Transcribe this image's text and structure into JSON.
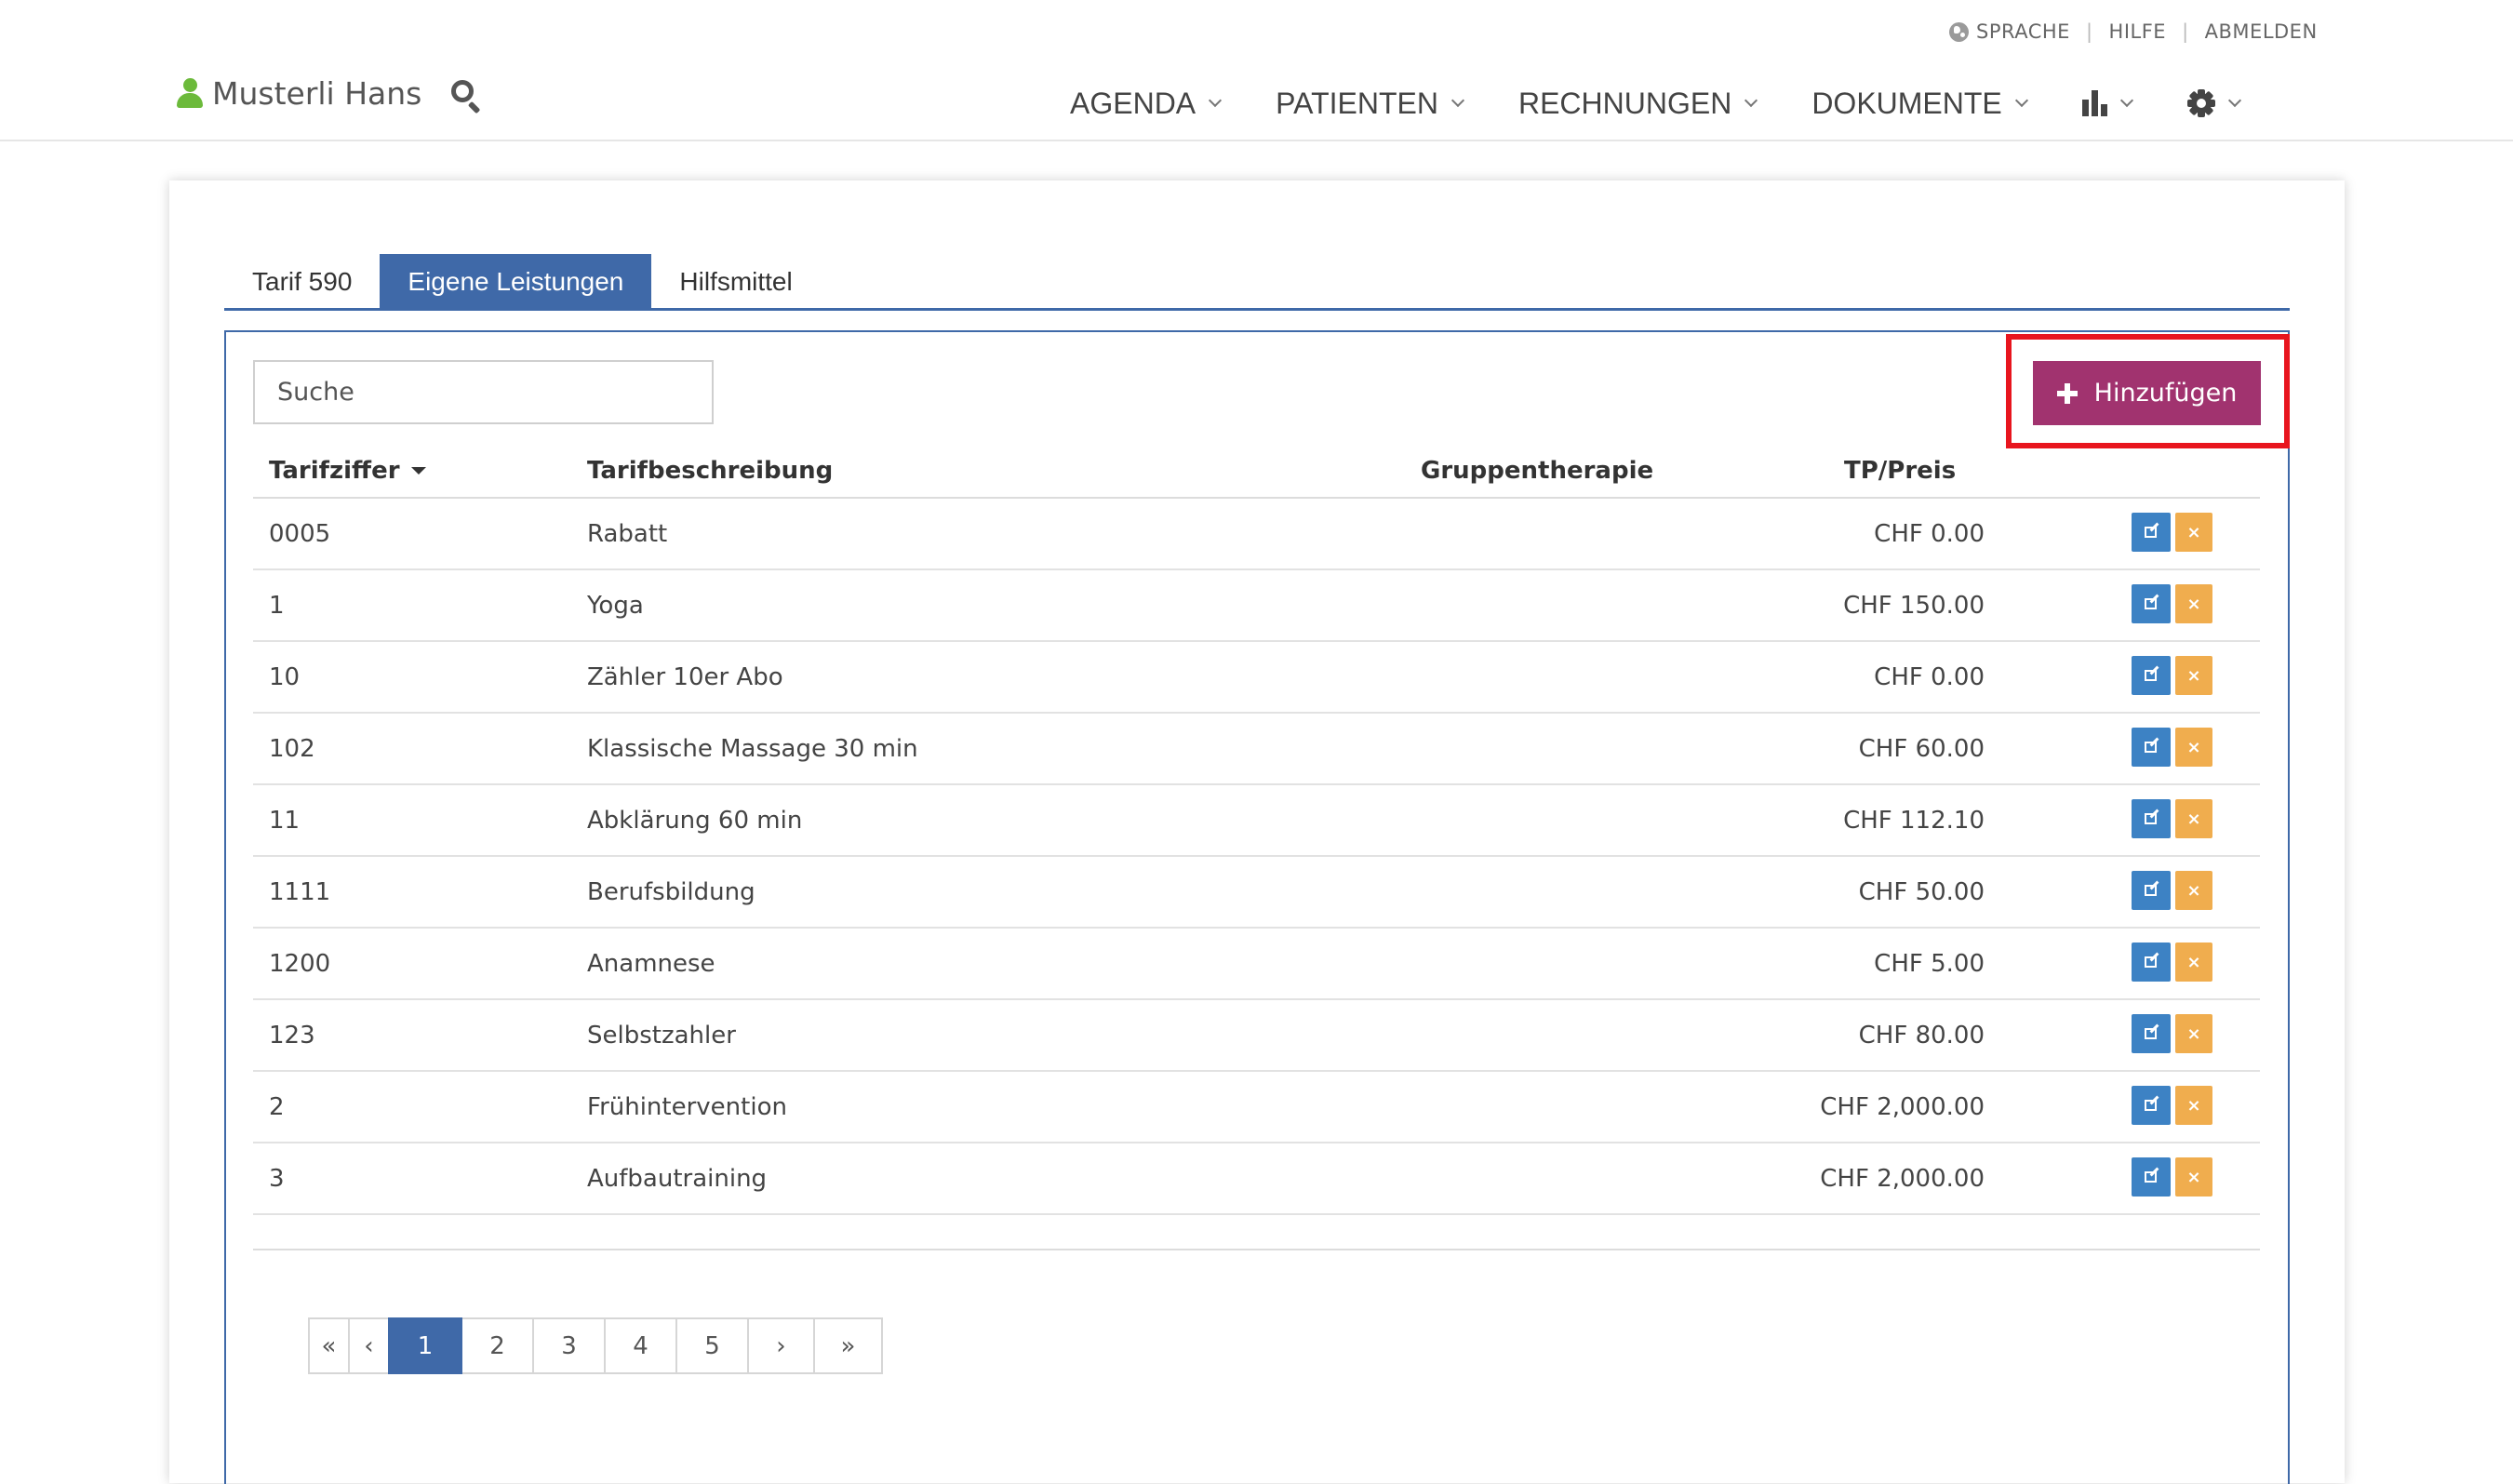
{
  "toplinks": {
    "language": "SPRACHE",
    "help": "HILFE",
    "logout": "ABMELDEN"
  },
  "header": {
    "user_name": "Musterli Hans"
  },
  "nav": {
    "agenda": "AGENDA",
    "patients": "PATIENTEN",
    "invoices": "RECHNUNGEN",
    "documents": "DOKUMENTE"
  },
  "tabs": [
    {
      "label": "Tarif 590"
    },
    {
      "label": "Eigene Leistungen",
      "active": true
    },
    {
      "label": "Hilfsmittel"
    }
  ],
  "search": {
    "placeholder": "Suche"
  },
  "add_button": {
    "label": "Hinzufügen"
  },
  "table": {
    "columns": {
      "code": "Tarifziffer",
      "description": "Tarifbeschreibung",
      "group": "Gruppentherapie",
      "price": "TP/Preis"
    },
    "rows": [
      {
        "code": "0005",
        "description": "Rabatt",
        "group": "",
        "price": "CHF 0.00"
      },
      {
        "code": "1",
        "description": "Yoga",
        "group": "",
        "price": "CHF 150.00"
      },
      {
        "code": "10",
        "description": "Zähler 10er Abo",
        "group": "",
        "price": "CHF 0.00"
      },
      {
        "code": "102",
        "description": "Klassische Massage 30 min",
        "group": "",
        "price": "CHF 60.00"
      },
      {
        "code": "11",
        "description": "Abklärung 60 min",
        "group": "",
        "price": "CHF 112.10"
      },
      {
        "code": "1111",
        "description": "Berufsbildung",
        "group": "",
        "price": "CHF 50.00"
      },
      {
        "code": "1200",
        "description": "Anamnese",
        "group": "",
        "price": "CHF 5.00"
      },
      {
        "code": "123",
        "description": "Selbstzahler",
        "group": "",
        "price": "CHF 80.00"
      },
      {
        "code": "2",
        "description": "Frühintervention",
        "group": "",
        "price": "CHF 2,000.00"
      },
      {
        "code": "3",
        "description": "Aufbautraining",
        "group": "",
        "price": "CHF 2,000.00"
      }
    ],
    "delete_symbol": "×"
  },
  "pagination": {
    "first": "«",
    "prev": "‹",
    "pages": [
      "1",
      "2",
      "3",
      "4",
      "5"
    ],
    "active": "1",
    "next": "›",
    "last": "»"
  },
  "colors": {
    "primary": "#3f69a8",
    "add_button": "#a1336f",
    "edit": "#3d82c4",
    "delete": "#f0ad4e",
    "highlight": "#e8151e",
    "user_icon": "#6cba3b"
  }
}
